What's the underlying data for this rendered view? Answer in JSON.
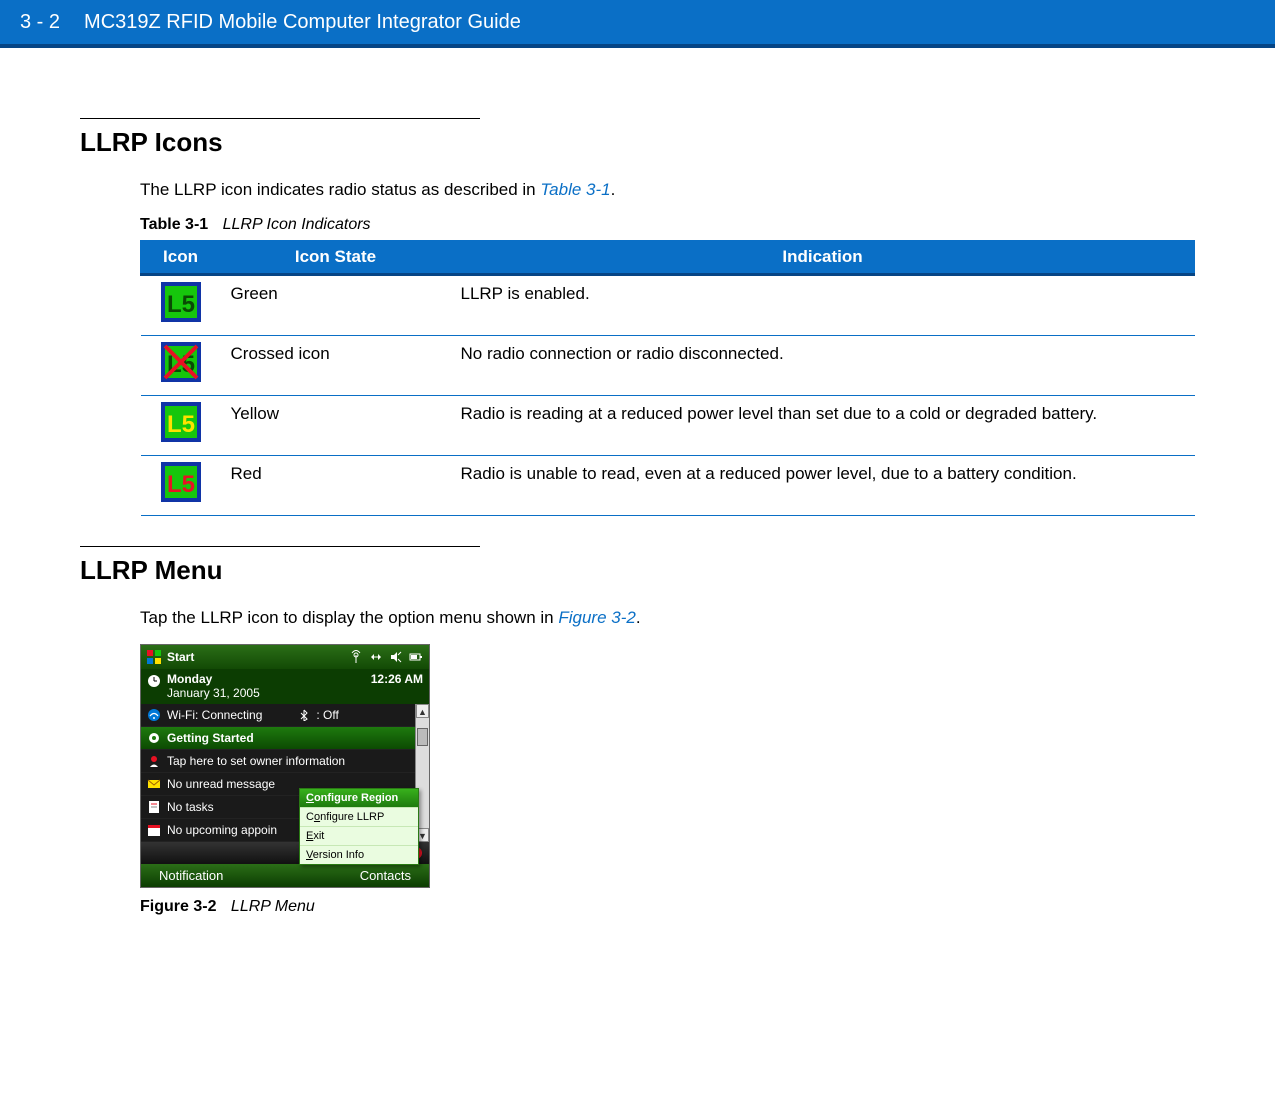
{
  "header": {
    "page_number": "3 - 2",
    "doc_title": "MC319Z RFID Mobile Computer Integrator Guide"
  },
  "section1": {
    "heading": "LLRP Icons",
    "intro_pre": "The LLRP icon indicates radio status as described in ",
    "intro_ref": "Table 3-1",
    "intro_post": "."
  },
  "table1": {
    "caption_label": "Table 3-1",
    "caption_title": "LLRP Icon Indicators",
    "headers": {
      "icon": "Icon",
      "state": "Icon State",
      "indication": "Indication"
    },
    "rows": [
      {
        "state": "Green",
        "indication": "LLRP is enabled."
      },
      {
        "state": "Crossed icon",
        "indication": "No radio connection or radio disconnected."
      },
      {
        "state": "Yellow",
        "indication": "Radio is reading at a reduced power level than set due to a cold or degraded battery."
      },
      {
        "state": "Red",
        "indication": "Radio is unable to read, even at a reduced power level, due to a battery condition."
      }
    ]
  },
  "section2": {
    "heading": "LLRP Menu",
    "intro_pre": "Tap the LLRP icon to display the option menu shown in ",
    "intro_ref": "Figure 3-2",
    "intro_post": "."
  },
  "screenshot": {
    "titlebar": {
      "label": "Start"
    },
    "dateline": {
      "day": "Monday",
      "date": "January 31, 2005",
      "time": "12:26 AM"
    },
    "rows": {
      "wifi_label": "Wi-Fi: Connecting",
      "bt_label": ": Off",
      "getting_started": "Getting Started",
      "owner": "Tap here to set owner information",
      "messages": "No unread message",
      "tasks": "No tasks",
      "appointments": "No upcoming appoin"
    },
    "menu": {
      "items": [
        {
          "label": "Configure Region"
        },
        {
          "label": "Configure LLRP"
        },
        {
          "label": "Exit"
        },
        {
          "label": "Version Info"
        }
      ]
    },
    "softbar": {
      "left": "Notification",
      "right": "Contacts"
    }
  },
  "figure1": {
    "caption_label": "Figure 3-2",
    "caption_title": "LLRP Menu"
  }
}
